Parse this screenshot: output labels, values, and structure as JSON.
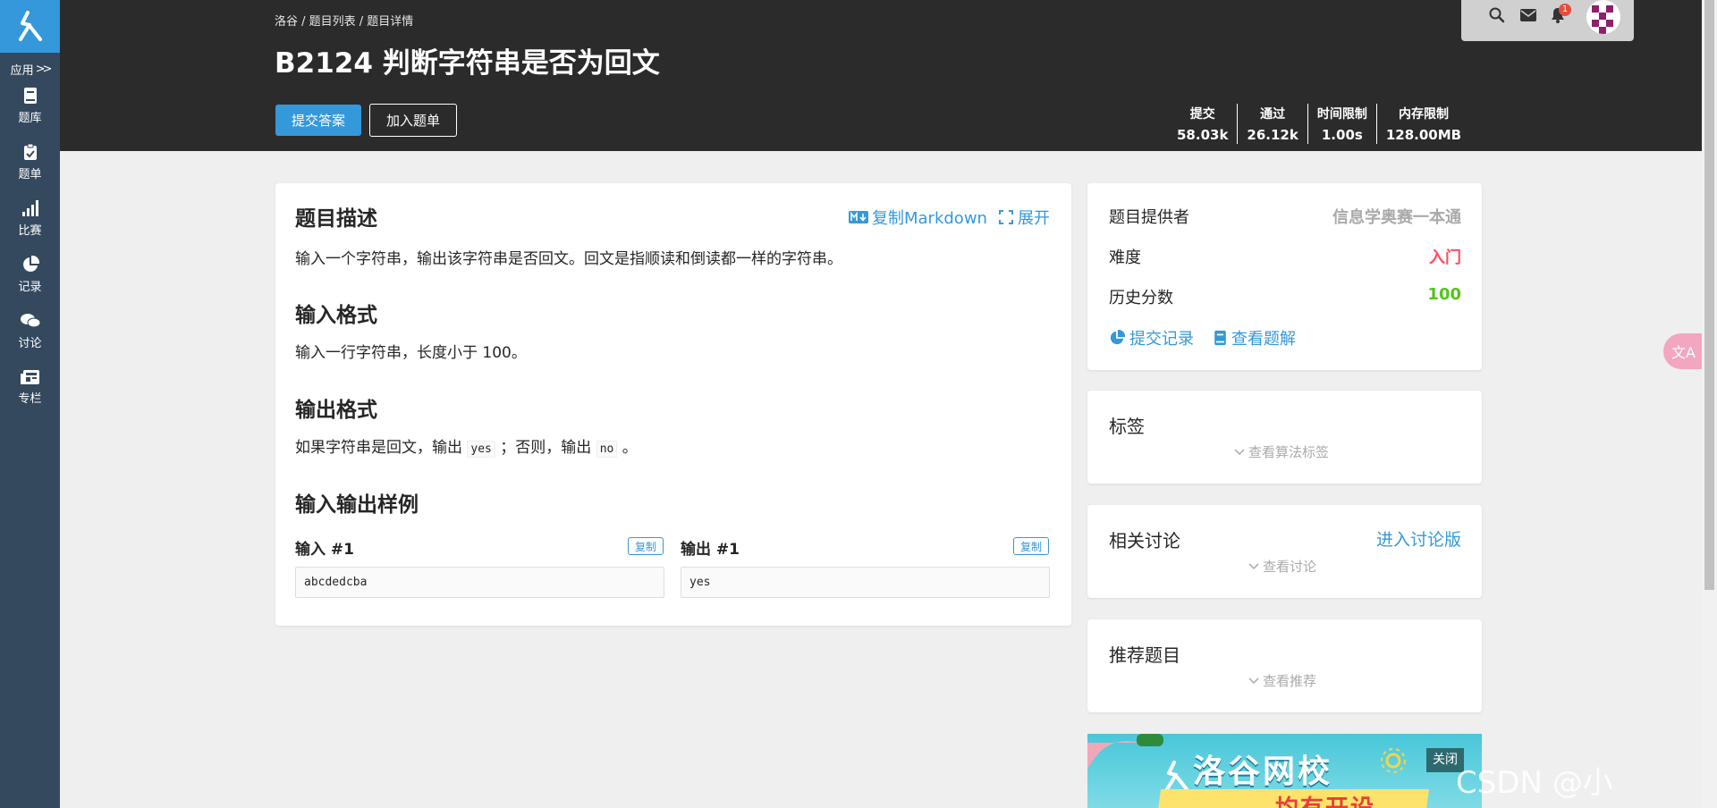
{
  "sidebar": {
    "apps_label": "应用",
    "items": [
      {
        "label": "题库",
        "icon": "book-icon"
      },
      {
        "label": "题单",
        "icon": "clipboard-icon"
      },
      {
        "label": "比赛",
        "icon": "bar-chart-icon"
      },
      {
        "label": "记录",
        "icon": "pie-chart-icon"
      },
      {
        "label": "讨论",
        "icon": "chat-icon"
      },
      {
        "label": "专栏",
        "icon": "newspaper-icon"
      }
    ]
  },
  "header": {
    "breadcrumb": "洛谷 / 题目列表 / 题目详情",
    "title": "B2124 判断字符串是否为回文",
    "submit_label": "提交答案",
    "add_label": "加入题单",
    "stats": [
      {
        "label": "提交",
        "value": "58.03k"
      },
      {
        "label": "通过",
        "value": "26.12k"
      },
      {
        "label": "时间限制",
        "value": "1.00s"
      },
      {
        "label": "内存限制",
        "value": "128.00MB"
      }
    ],
    "notification_count": "1"
  },
  "problem": {
    "desc_title": "题目描述",
    "copy_md_label": "复制Markdown",
    "expand_label": "展开",
    "description": "输入一个字符串，输出该字符串是否回文。回文是指顺读和倒读都一样的字符串。",
    "input_title": "输入格式",
    "input_text": "输入一行字符串，长度小于 100。",
    "output_title": "输出格式",
    "output_prefix": "如果字符串是回文，输出",
    "output_yes": "yes",
    "output_mid": "；否则，输出",
    "output_no": "no",
    "output_suffix": "。",
    "samples_title": "输入输出样例",
    "sample_input_label": "输入 #1",
    "sample_output_label": "输出 #1",
    "copy_label": "复制",
    "sample_input": "abcdedcba",
    "sample_output": "yes"
  },
  "info": {
    "provider_label": "题目提供者",
    "provider_value": "信息学奥赛一本通",
    "difficulty_label": "难度",
    "difficulty_value": "入门",
    "score_label": "历史分数",
    "score_value": "100",
    "records_link": "提交记录",
    "solutions_link": "查看题解",
    "colors": {
      "difficulty": "#fe4c61",
      "score": "#52c41a",
      "accent": "#3498db"
    }
  },
  "tags": {
    "title": "标签",
    "toggle": "查看算法标签"
  },
  "discuss": {
    "title": "相关讨论",
    "enter_link": "进入讨论版",
    "toggle": "查看讨论"
  },
  "recommend": {
    "title": "推荐题目",
    "toggle": "查看推荐"
  },
  "ad": {
    "title": "洛谷网校",
    "subtitle": "均有开设",
    "close_label": "关闭"
  },
  "watermark": "CSDN @小",
  "translate_label": "文A"
}
